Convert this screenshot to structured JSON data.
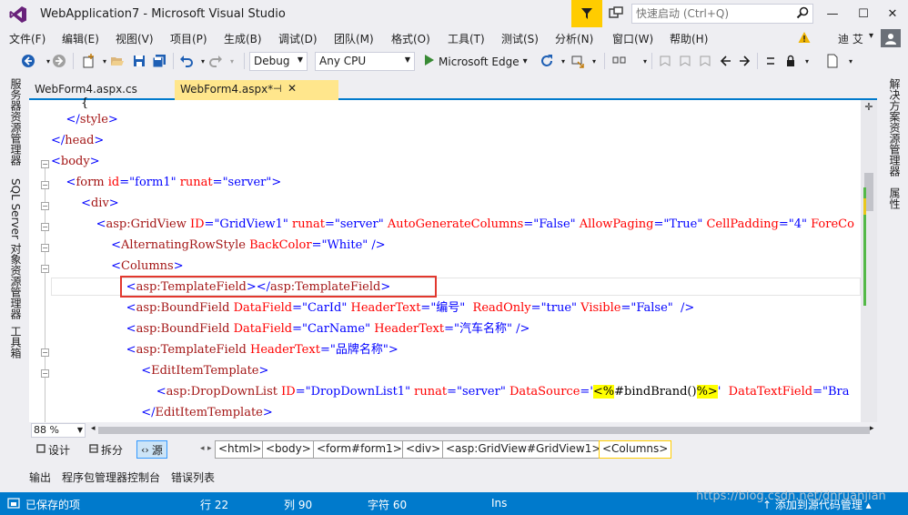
{
  "window": {
    "title": "WebApplication7 - Microsoft Visual Studio",
    "quick_launch_placeholder": "快速启动 (Ctrl+Q)",
    "minimize_glyph": "—",
    "maximize_glyph": "☐",
    "close_glyph": "✕"
  },
  "menu": {
    "items": [
      {
        "label": "文件(F)"
      },
      {
        "label": "编辑(E)"
      },
      {
        "label": "视图(V)"
      },
      {
        "label": "项目(P)"
      },
      {
        "label": "生成(B)"
      },
      {
        "label": "调试(D)"
      },
      {
        "label": "团队(M)"
      },
      {
        "label": "格式(O)"
      },
      {
        "label": "工具(T)"
      },
      {
        "label": "测试(S)"
      },
      {
        "label": "分析(N)"
      },
      {
        "label": "窗口(W)"
      },
      {
        "label": "帮助(H)"
      }
    ],
    "user_name": "迪 艾",
    "user_caret": "▾"
  },
  "toolbar": {
    "configuration": "Debug",
    "platform": "Any CPU",
    "run_target": "Microsoft Edge",
    "run_caret": "▾"
  },
  "side_panels": {
    "left": [
      "服务器资源管理器",
      "SQL Server 对象资源管理器",
      "工具箱"
    ],
    "right": [
      "解决方案资源管理器",
      "属性"
    ]
  },
  "doc_tabs": [
    {
      "label": "WebForm4.aspx.cs",
      "active": false
    },
    {
      "label": "WebForm4.aspx*",
      "active": true,
      "pin": "⊣",
      "close": "✕"
    }
  ],
  "editor": {
    "zoom": "88 %",
    "lines": {
      "l0": "        {",
      "l1": {
        "indent": "    ",
        "open": "</",
        "tag": "style",
        "close": ">"
      },
      "l2": {
        "open": "</",
        "tag": "head",
        "close": ">"
      },
      "l3": {
        "open": "<",
        "tag": "body",
        "close": ">"
      },
      "l4": {
        "indent": "    ",
        "open": "<",
        "tag": "form",
        "a1": " id",
        "eq1": "=",
        "v1": "\"form1\"",
        "a2": " runat",
        "eq2": "=",
        "v2": "\"server\"",
        "close": ">"
      },
      "l5": {
        "indent": "        ",
        "open": "<",
        "tag": "div",
        "close": ">"
      },
      "l6": {
        "indent": "            ",
        "open": "<",
        "tag": "asp:GridView",
        "a1": " ID",
        "eq1": "=",
        "v1": "\"GridView1\"",
        "a2": " runat",
        "eq2": "=",
        "v2": "\"server\"",
        "a3": " AutoGenerateColumns",
        "eq3": "=",
        "v3": "\"False\"",
        "a4": " AllowPaging",
        "eq4": "=",
        "v4": "\"True\"",
        "a5": " CellPadding",
        "eq5": "=",
        "v5": "\"4\"",
        "a6": " ForeCo"
      },
      "l7": {
        "indent": "                ",
        "open": "<",
        "tag": "AlternatingRowStyle",
        "a1": " BackColor",
        "eq1": "=",
        "v1": "\"White\"",
        "close": " />"
      },
      "l8": {
        "indent": "                ",
        "open": "<",
        "tag": "Columns",
        "close": ">"
      },
      "l9": {
        "indent": "                    ",
        "open": "<",
        "tag": "asp:TemplateField",
        "mid": "></",
        "tag2": "asp:TemplateField",
        "close": ">"
      },
      "l10": {
        "indent": "                    ",
        "open": "<",
        "tag": "asp:BoundField",
        "a1": " DataField",
        "eq1": "=",
        "v1": "\"CarId\"",
        "a2": " HeaderText",
        "eq2": "=",
        "v2": "\"编号\"",
        "a3": "  ReadOnly",
        "eq3": "=",
        "v3": "\"true\"",
        "a4": " Visible",
        "eq4": "=",
        "v4": "\"False\"",
        "close": "  />"
      },
      "l11": {
        "indent": "                    ",
        "open": "<",
        "tag": "asp:BoundField",
        "a1": " DataField",
        "eq1": "=",
        "v1": "\"CarName\"",
        "a2": " HeaderText",
        "eq2": "=",
        "v2": "\"汽车名称\"",
        "close": " />"
      },
      "l12": {
        "indent": "                    ",
        "open": "<",
        "tag": "asp:TemplateField",
        "a1": " HeaderText",
        "eq1": "=",
        "v1": "\"品牌名称\"",
        "close": ">"
      },
      "l13": {
        "indent": "                        ",
        "open": "<",
        "tag": "EditItemTemplate",
        "close": ">"
      },
      "l14": {
        "indent": "                            ",
        "open": "<",
        "tag": "asp:DropDownList",
        "a1": " ID",
        "eq1": "=",
        "v1": "\"DropDownList1\"",
        "a2": " runat",
        "eq2": "=",
        "v2": "\"server\"",
        "a3": " DataSource",
        "eq3": "=",
        "q1": "'",
        "hl1": "<%",
        "code": "#bindBrand()",
        "hl2": "%>",
        "q2": "'",
        "a4": "  DataTextField",
        "eq4": "=",
        "v4": "\"Bra"
      },
      "l15": {
        "indent": "                        ",
        "open": "</",
        "tag": "EditItemTemplate",
        "close": ">"
      }
    }
  },
  "view_bar": {
    "design": "设计",
    "split": "拆分",
    "source": "源",
    "breadcrumbs": [
      "<html>",
      "<body>",
      "<form#form1>",
      "<div>",
      "<asp:GridView#GridView1>",
      "<Columns>"
    ]
  },
  "bottom_tabs": [
    "输出",
    "程序包管理器控制台",
    "错误列表"
  ],
  "status": {
    "saved": "已保存的项",
    "line": "行 22",
    "col": "列 90",
    "char": "字符 60",
    "mode": "Ins",
    "add_source": "↑ 添加到源代码管理 ▴"
  },
  "watermark": "https://blog.csdn.net/dnruanjian",
  "colors": {
    "accent": "#007acc",
    "tab_active": "#ffe68c",
    "highlight_box": "#e2382e",
    "code_tag": "#a31515",
    "code_attr": "#ff0000",
    "code_value": "#0000ff"
  }
}
